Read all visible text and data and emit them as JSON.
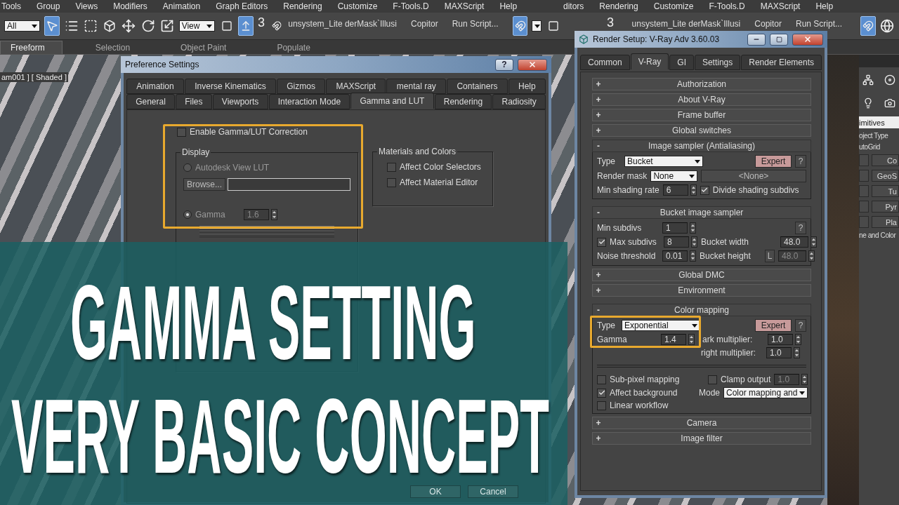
{
  "menu_bar": [
    "Tools",
    "Group",
    "Views",
    "Modifiers",
    "Animation",
    "Graph Editors",
    "Rendering",
    "Customize",
    "F-Tools.D",
    "MAXScript",
    "Help"
  ],
  "menu_bar_right": [
    "ditors",
    "Rendering",
    "Customize",
    "F-Tools.D",
    "MAXScript",
    "Help"
  ],
  "toolbar": {
    "selection_filter": "All",
    "view_dropdown": "View",
    "snap_label": "3",
    "script_items": [
      "unsystem_Lite derMask`Illusi",
      "Copitor",
      "Run Script..."
    ],
    "snap_label_2": "3",
    "script_items_2": [
      "unsystem_Lite derMask`Illusi",
      "Copitor",
      "Run Script..."
    ]
  },
  "ribbon_tabs": [
    {
      "label": "Freeform",
      "selected": true
    },
    {
      "label": "Selection",
      "selected": false
    },
    {
      "label": "Object Paint",
      "selected": false
    },
    {
      "label": "Populate",
      "selected": false
    }
  ],
  "viewport_label": "am001 ] [ Shaded ]",
  "command_panel": {
    "category": "imitives",
    "rollout_title": "oject Type",
    "autogrid": "utoGrid",
    "buttons": [
      "Co",
      "GeoS",
      "Tu",
      "Pyr",
      "Pla"
    ],
    "section_title": "ne and Color"
  },
  "preference_window": {
    "title": "Preference Settings",
    "help_button": "?",
    "tab_rows": [
      [
        {
          "label": "Animation",
          "selected": false
        },
        {
          "label": "Inverse Kinematics",
          "selected": false
        },
        {
          "label": "Gizmos",
          "selected": false
        },
        {
          "label": "MAXScript",
          "selected": false
        },
        {
          "label": "mental ray",
          "selected": false
        },
        {
          "label": "Containers",
          "selected": false
        },
        {
          "label": "Help",
          "selected": false
        }
      ],
      [
        {
          "label": "General",
          "selected": false
        },
        {
          "label": "Files",
          "selected": false
        },
        {
          "label": "Viewports",
          "selected": false
        },
        {
          "label": "Interaction Mode",
          "selected": false
        },
        {
          "label": "Gamma and LUT",
          "selected": true
        },
        {
          "label": "Rendering",
          "selected": false
        },
        {
          "label": "Radiosity",
          "selected": false
        }
      ]
    ],
    "enable_gamma": {
      "label": "Enable Gamma/LUT Correction",
      "checked": false
    },
    "display_group": {
      "title": "Display",
      "lut_option": {
        "label": "Autodesk View LUT",
        "selected": false
      },
      "browse_button": "Browse...",
      "gamma_option": {
        "label": "Gamma",
        "selected": true
      },
      "gamma_value": "1.6"
    },
    "materials_group": {
      "title": "Materials and Colors",
      "options": [
        {
          "label": "Affect Color Selectors",
          "checked": false
        },
        {
          "label": "Affect Material Editor",
          "checked": false
        }
      ]
    },
    "buttons": [
      "OK",
      "Cancel"
    ]
  },
  "render_window": {
    "title": "Render Setup: V-Ray Adv 3.60.03",
    "tabs": [
      {
        "label": "Common",
        "selected": false
      },
      {
        "label": "V-Ray",
        "selected": true
      },
      {
        "label": "GI",
        "selected": false
      },
      {
        "label": "Settings",
        "selected": false
      },
      {
        "label": "Render Elements",
        "selected": false
      }
    ],
    "rollouts": [
      {
        "toggle": "+",
        "title": "Authorization",
        "expanded": false
      },
      {
        "toggle": "+",
        "title": "About V-Ray",
        "expanded": false
      },
      {
        "toggle": "+",
        "title": "Frame buffer",
        "expanded": false
      },
      {
        "toggle": "+",
        "title": "Global switches",
        "expanded": false
      },
      {
        "toggle": "-",
        "title": "Image sampler (Antialiasing)",
        "expanded": true,
        "kind": "image_sampler",
        "type_label": "Type",
        "type_value": "Bucket",
        "expert": "Expert",
        "help": "?",
        "mask_label": "Render mask",
        "mask_value": "None",
        "mask_object": "<None>",
        "rate_label": "Min shading rate",
        "rate_value": "6",
        "divide": {
          "label": "Divide shading subdivs",
          "checked": true
        }
      },
      {
        "toggle": "-",
        "title": "Bucket image sampler",
        "expanded": true,
        "kind": "bucket",
        "min_label": "Min subdivs",
        "min_value": "1",
        "help": "?",
        "max": {
          "label": "Max subdivs",
          "checked": true,
          "value": "8"
        },
        "noise_label": "Noise threshold",
        "noise_value": "0.01",
        "width_label": "Bucket width",
        "width_value": "48.0",
        "height_label": "Bucket height",
        "lock": "L",
        "height_value": "48.0"
      },
      {
        "toggle": "+",
        "title": "Global DMC",
        "expanded": false
      },
      {
        "toggle": "+",
        "title": "Environment",
        "expanded": false
      },
      {
        "toggle": "-",
        "title": "Color mapping",
        "expanded": true,
        "kind": "color_mapping",
        "type_label": "Type",
        "type_value": "Exponential",
        "expert": "Expert",
        "help": "?",
        "gamma_label": "Gamma",
        "gamma_value": "1.4",
        "dark_label": "ark multiplier:",
        "dark_value": "1.0",
        "bright_label": "right multiplier:",
        "bright_value": "1.0",
        "sub_pixel": {
          "label": "Sub-pixel mapping",
          "checked": false
        },
        "clamp": {
          "label": "Clamp output",
          "checked": false,
          "value": "1.0"
        },
        "affect_background": {
          "label": "Affect background",
          "checked": true
        },
        "mode_label": "Mode",
        "mode_value": "Color mapping and",
        "linear_workflow": {
          "label": "Linear workflow",
          "checked": false
        }
      },
      {
        "toggle": "+",
        "title": "Camera",
        "expanded": false
      },
      {
        "toggle": "+",
        "title": "Image filter",
        "expanded": false
      }
    ]
  },
  "overlay_title": [
    "GAMMA SETTING",
    "VERY BASIC CONCEPT"
  ]
}
